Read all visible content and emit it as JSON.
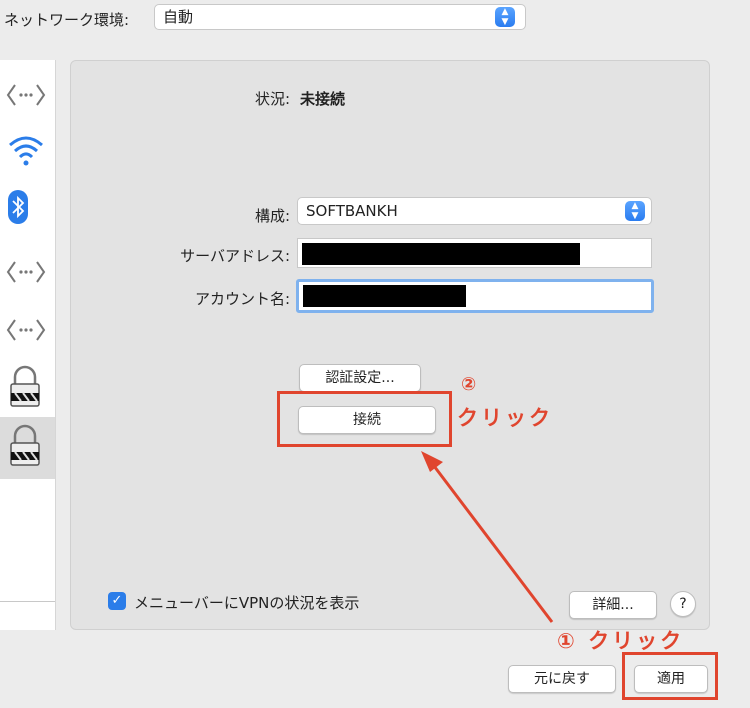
{
  "location": {
    "label": "ネットワーク環境:",
    "value": "自動"
  },
  "sidebar": {
    "icons": [
      "ethernet-dots-icon",
      "wifi-icon",
      "bluetooth-icon",
      "ethernet-dots-icon",
      "ethernet-dots-icon",
      "lock-icon",
      "lock-icon"
    ]
  },
  "panel": {
    "status_label": "状況:",
    "status_value": "未接続",
    "config_label": "構成:",
    "config_value": "SOFTBANKH",
    "server_label": "サーバアドレス:",
    "account_label": "アカウント名:",
    "auth_button": "認証設定...",
    "connect_button": "接続",
    "show_vpn_label": "メニューバーにVPNの状況を表示",
    "show_vpn_checked": true,
    "detail_button": "詳細...",
    "help_button": "?"
  },
  "footer": {
    "revert_button": "元に戻す",
    "apply_button": "適用"
  },
  "annotations": {
    "step2_num": "②",
    "step2_text": "クリック",
    "step1_text": "① クリック",
    "color": "#e0452e"
  }
}
